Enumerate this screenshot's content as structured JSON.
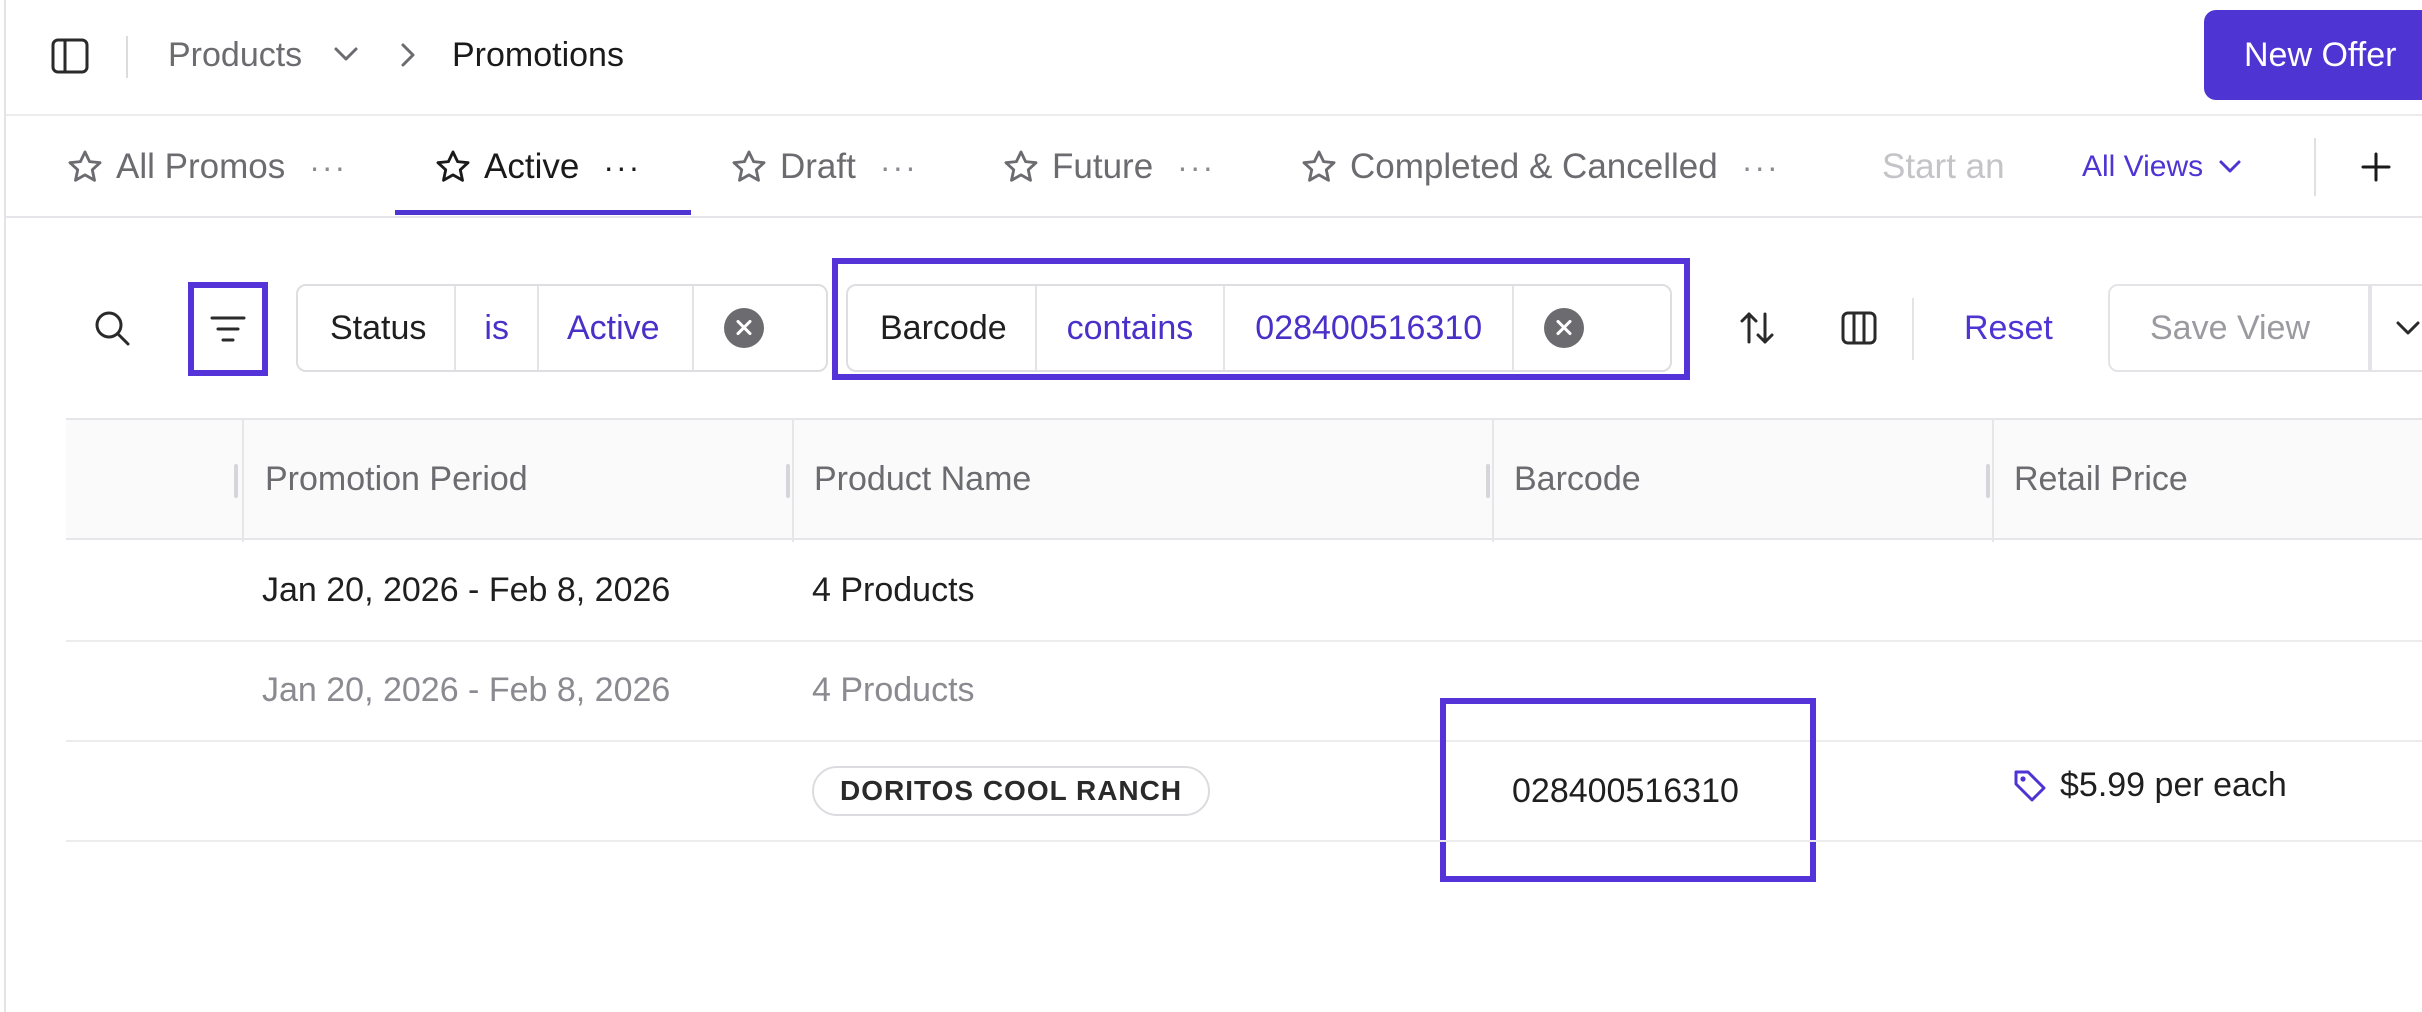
{
  "breadcrumb": {
    "products": "Products",
    "current": "Promotions"
  },
  "header": {
    "new_offer_label": "New Offer"
  },
  "tabs": [
    {
      "label": "All Promos"
    },
    {
      "label": "Active"
    },
    {
      "label": "Draft"
    },
    {
      "label": "Future"
    },
    {
      "label": "Completed & Cancelled"
    },
    {
      "label": "Start an"
    }
  ],
  "all_views_label": "All Views",
  "filters": [
    {
      "field": "Status",
      "operator": "is",
      "value": "Active"
    },
    {
      "field": "Barcode",
      "operator": "contains",
      "value": "028400516310"
    }
  ],
  "toolbar": {
    "reset_label": "Reset",
    "save_view_label": "Save View"
  },
  "table": {
    "columns": [
      "Promotion Period",
      "Product Name",
      "Barcode",
      "Retail Price"
    ],
    "rows": [
      {
        "period": "Jan 20, 2026 - Feb 8, 2026",
        "product": "4 Products"
      },
      {
        "period": "Jan 20, 2026 - Feb 8, 2026",
        "product": "4 Products"
      },
      {
        "product_tag": "DORITOS COOL RANCH",
        "barcode": "028400516310",
        "price": "$5.99 per each"
      }
    ]
  },
  "colors": {
    "accent": "#4f34d4",
    "highlight": "#5433d9"
  }
}
